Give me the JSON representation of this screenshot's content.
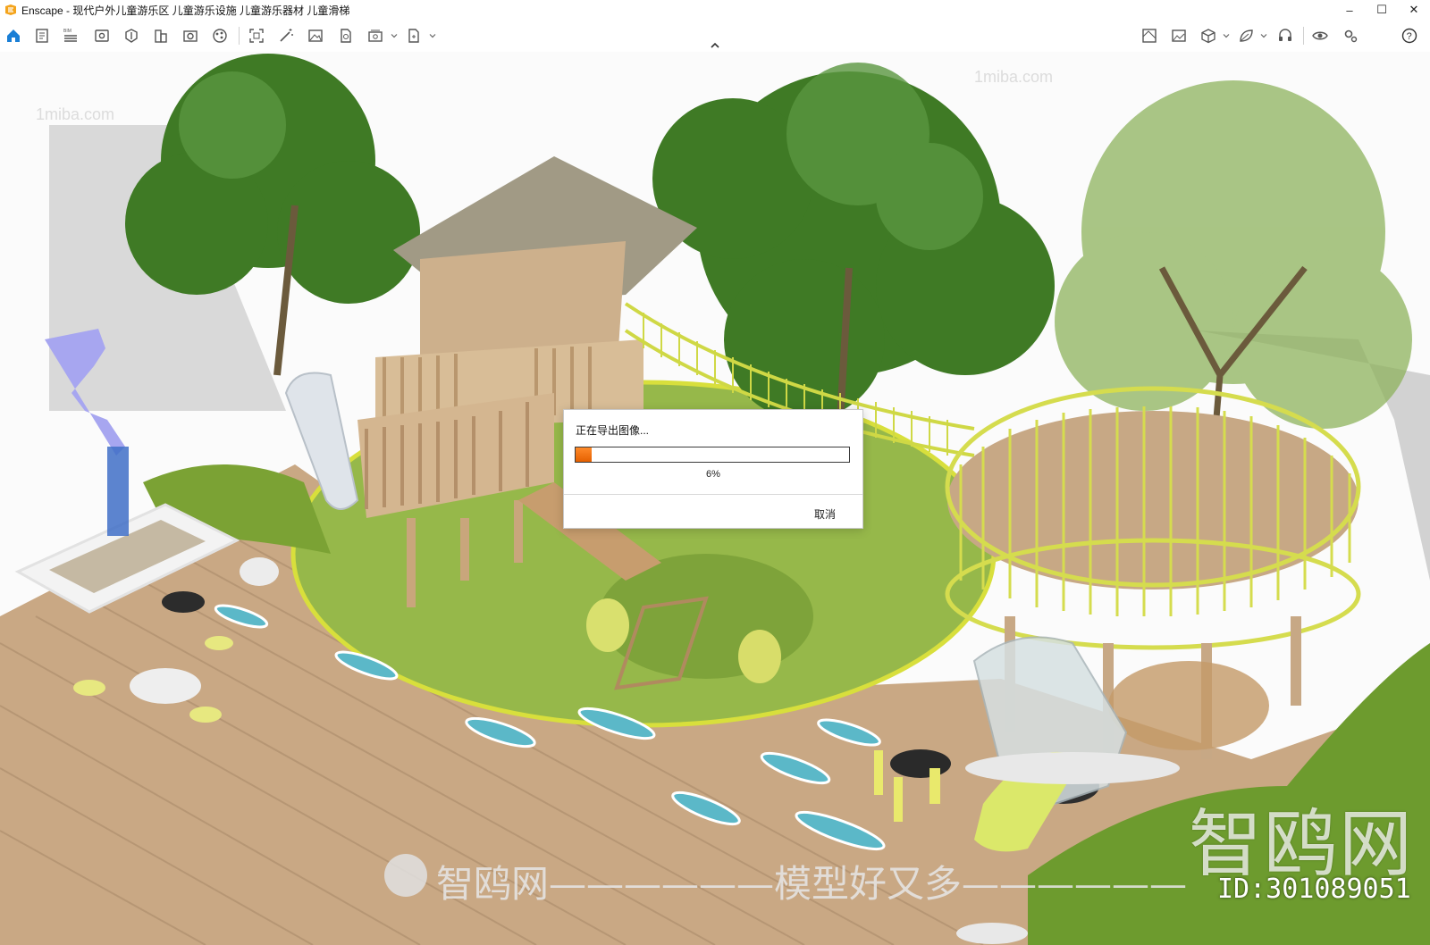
{
  "window": {
    "app_name": "Enscape",
    "title": "Enscape - 现代户外儿童游乐区 儿童游乐设施 儿童游乐器材 儿童滑梯",
    "controls": {
      "minimize": "–",
      "maximize": "☐",
      "close": "✕"
    }
  },
  "toolbar": {
    "left_icons": [
      "home-icon",
      "document-icon",
      "bim-list-icon",
      "view-icon",
      "asset-library-icon",
      "building-icon",
      "camera-views-icon",
      "material-editor-icon",
      "render-region-icon",
      "magic-wand-icon",
      "image-export-icon",
      "file-export-icon",
      "batch-render-icon",
      "export-dropdown-icon"
    ],
    "right_icons": [
      "map-icon",
      "image-icon",
      "cube-icon",
      "leaf-icon",
      "headset-icon",
      "eye-icon",
      "settings-icon",
      "help-icon"
    ],
    "bim_label": "BIM"
  },
  "dialog": {
    "title": "正在导出图像...",
    "progress_label": "6%",
    "progress_value": 0.06,
    "cancel_label": "取消"
  },
  "watermarks": {
    "brand": "智鸥网",
    "id": "ID:301089051",
    "slogan": "智鸥网——————模型好又多——————",
    "site": "1miba.com"
  },
  "colors": {
    "accent_orange": "#e56000",
    "home_blue": "#1a7fd6"
  }
}
